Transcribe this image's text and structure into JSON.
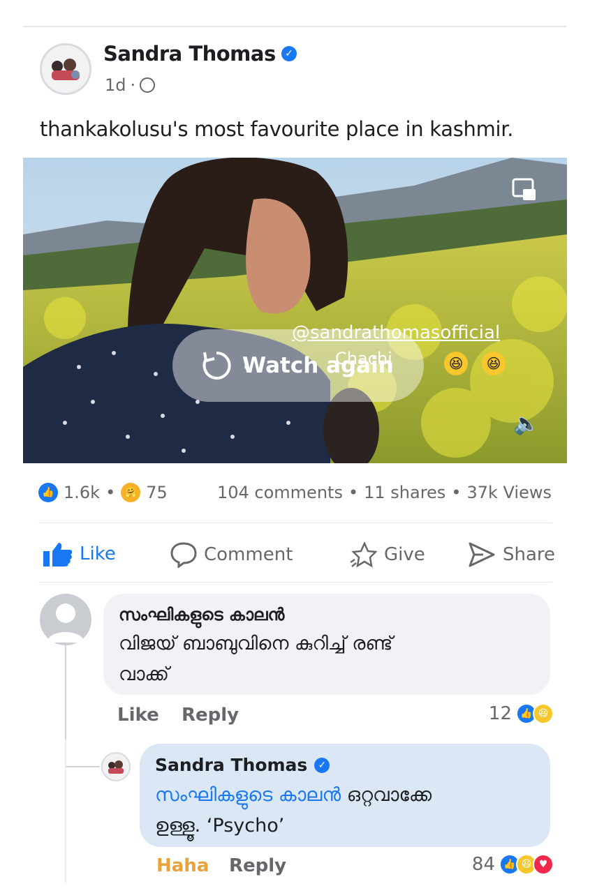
{
  "post": {
    "author": "Sandra Thomas",
    "time": "1d",
    "separator": "·",
    "caption": "thankakolusu's most favourite place in kashmir."
  },
  "video": {
    "watch_again": "Watch again",
    "overlay_tag": "@sandrathomasofficial",
    "overlay_name": "Chachi"
  },
  "stats": {
    "likes": "1.6k",
    "care": "75",
    "comments": "104 comments",
    "shares": "11 shares",
    "views": "37k Views"
  },
  "actions": {
    "like": "Like",
    "comment": "Comment",
    "give": "Give",
    "share": "Share"
  },
  "comment1": {
    "name": "സംഘികളുടെ കാലൻ",
    "line1": "വിജയ് ബാബുവിനെ കുറിച്ച് രണ്ട്",
    "line2": "വാക്ക്",
    "like": "Like",
    "reply": "Reply",
    "count": "12"
  },
  "reply1": {
    "name": "Sandra Thomas",
    "mention": "സംഘികളുടെ കാലൻ",
    "text_after": " ഒറ്റവാക്കേ",
    "line2": "ഉള്ളൂ. ‘Psycho’",
    "haha": "Haha",
    "reply": "Reply",
    "count": "84"
  },
  "colors": {
    "accent": "#1877f2",
    "haha": "#e8a33d",
    "text": "#1c1e21",
    "muted": "#65676b"
  }
}
